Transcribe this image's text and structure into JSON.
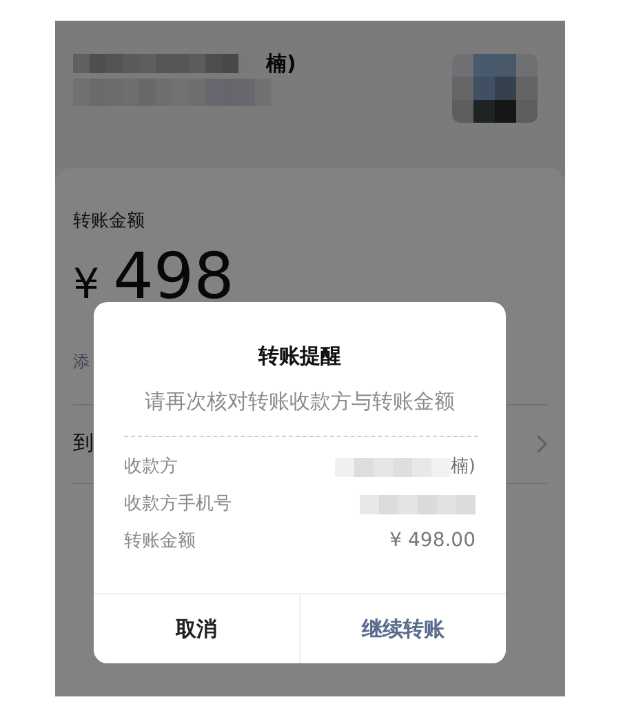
{
  "header": {
    "recipient_suffix": "楠)"
  },
  "amount_section": {
    "label": "转账金额",
    "currency": "¥",
    "amount": "498",
    "note_partial": "添",
    "row_partial": "到"
  },
  "dialog": {
    "title": "转账提醒",
    "message": "请再次核对转账收款方与转账金额",
    "rows": [
      {
        "label": "收款方",
        "masked": true,
        "value": "楠)"
      },
      {
        "label": "收款方手机号",
        "masked": true
      },
      {
        "label": "转账金额",
        "masked": false,
        "value": "¥ 498.00"
      }
    ],
    "buttons": [
      {
        "label": "取消",
        "kind": "cancel"
      },
      {
        "label": "继续转账",
        "kind": "confirm"
      }
    ]
  }
}
